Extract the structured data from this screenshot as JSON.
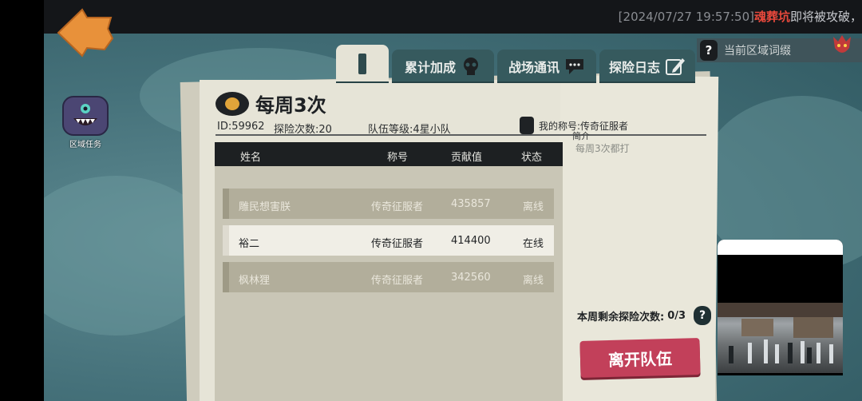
{
  "ticker": {
    "time": "[2024/07/27 19:57:50]",
    "place": "魂葬坑",
    "text": "即将被攻破，"
  },
  "region_task": {
    "label": "区域任务"
  },
  "region_affix": {
    "q": "?",
    "label": "当前区域词缀"
  },
  "tabs": [
    {
      "label": "累计加成",
      "icon": "skull-icon"
    },
    {
      "label": "战场通讯",
      "icon": "chat-icon"
    },
    {
      "label": "探险日志",
      "icon": "edit-icon"
    }
  ],
  "panel": {
    "title": "每周3次",
    "id": "ID:59962",
    "explore_count": "探险次数:20",
    "team_level": "队伍等级:4星小队",
    "my_title": "我的称号:传奇征服者",
    "intro_head": "简介",
    "intro_text": "每周3次都打"
  },
  "table": {
    "headers": {
      "name": "姓名",
      "title": "称号",
      "contribution": "贡献值",
      "status": "状态"
    },
    "rows": [
      {
        "name": "雕民想害朕",
        "title": "传奇征服者",
        "contribution": "435857",
        "status": "离线"
      },
      {
        "name": "裕二",
        "title": "传奇征服者",
        "contribution": "414400",
        "status": "在线"
      },
      {
        "name": "枫林狸",
        "title": "传奇征服者",
        "contribution": "342560",
        "status": "离线"
      }
    ]
  },
  "remaining": {
    "label": "本周剩余探险次数:",
    "value": "0/3",
    "q": "?"
  },
  "leave_button": "离开队伍",
  "colors": {
    "accent": "#c2405a",
    "orange": "#e8913a",
    "alert": "#e8493c",
    "tab": "#365a5e"
  }
}
